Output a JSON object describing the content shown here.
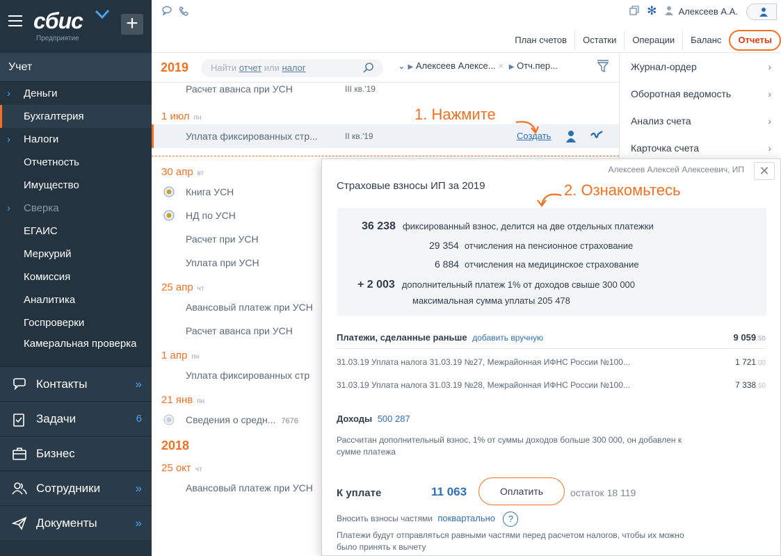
{
  "sidebar": {
    "logo": "сбис",
    "logo_sub": "Предприятие",
    "section": "Учет",
    "items": [
      {
        "label": "Деньги",
        "chevron": true
      },
      {
        "label": "Бухгалтерия",
        "active": true
      },
      {
        "label": "Налоги",
        "chevron": true
      },
      {
        "label": "Отчетность"
      },
      {
        "label": "Имущество"
      },
      {
        "label": "Сверка",
        "chevron": true,
        "muted": true
      },
      {
        "label": "ЕГАИС"
      },
      {
        "label": "Меркурий"
      },
      {
        "label": "Комиссия"
      },
      {
        "label": "Аналитика"
      },
      {
        "label": "Госпроверки"
      },
      {
        "label": "Камеральная проверка"
      }
    ],
    "big_sections": [
      {
        "label": "Контакты",
        "icon": "chat-icon",
        "arrow": "»"
      },
      {
        "label": "Задачи",
        "icon": "tasks-icon",
        "badge": "6"
      },
      {
        "label": "Бизнес",
        "icon": "briefcase-icon"
      },
      {
        "label": "Сотрудники",
        "icon": "people-icon",
        "arrow": "»"
      },
      {
        "label": "Документы",
        "icon": "send-icon",
        "arrow": "»"
      }
    ]
  },
  "topbar": {
    "user": "Алексеев А.А.",
    "tabs": [
      "План счетов",
      "Остатки",
      "Операции",
      "Баланс",
      "Отчеты"
    ],
    "active_tab": "Отчеты"
  },
  "listhead": {
    "year": "2019",
    "search_pre": "Найти ",
    "search_link1": "отчет",
    "search_mid": " или ",
    "search_link2": "налог",
    "filter1": "Алексеев Алексе...",
    "filter2": "Отч.пер..."
  },
  "list": {
    "r0_name": "Расчет аванса при УСН",
    "r0_per": "III кв.'19",
    "d1": "1 июл",
    "d1w": "пн",
    "r1_name": "Уплата фиксированных стр...",
    "r1_per": "II кв.'19",
    "r1_action": "Создать",
    "d2": "30 апр",
    "d2w": "вт",
    "r2": "Книга УСН",
    "r3": "НД по УСН",
    "r4": "Расчет при УСН",
    "r5": "Уплата при УСН",
    "d3": "25 апр",
    "d3w": "чт",
    "r6": "Авансовый платеж при УСН",
    "r7": "Расчет аванса при УСН",
    "d4": "1 апр",
    "d4w": "пн",
    "r8": "Уплата фиксированных стр",
    "d5": "21 янв",
    "d5w": "пн",
    "r9": "Сведения о средн...",
    "r9_num": "7676",
    "y2018": "2018",
    "d6": "25 окт",
    "d6w": "чт",
    "r10": "Авансовый платеж при УСН"
  },
  "rightpanel": {
    "items": [
      "Журнал-ордер",
      "Оборотная ведомость",
      "Анализ счета",
      "Карточка счета"
    ]
  },
  "annotations": {
    "a1": "1. Нажмите",
    "a2": "2. Ознакомьтесь"
  },
  "popup": {
    "company": "Алексеев Алексей Алексеевич, ИП",
    "title": "Страховые взносы ИП за 2019",
    "s1_val": "36 238",
    "s1_txt": "фиксированный взнос, делится на две отдельных платежки",
    "s2_val": "29 354",
    "s2_txt": "отчисления на пенсионное страхование",
    "s3_val": "6 884",
    "s3_txt": "отчисления на медицинское страхование",
    "s4_val": "+ 2 003",
    "s4_txt": "дополнительный платеж 1% от доходов свыше 300 000",
    "s5_txt": "максимальная сумма уплаты 205 478",
    "paid_label": "Платежи, сделанные раньше",
    "paid_add": "добавить вручную",
    "paid_total": "9 059",
    "paid_total_k": ".50",
    "pay1": "31.03.19  Уплата налога 31.03.19 №27, Межрайонная ИФНС России №100...",
    "pay1_amt": "1 721",
    "pay1_k": ".00",
    "pay2": "31.03.19  Уплата налога 31.03.19 №28, Межрайонная ИФНС России №100...",
    "pay2_amt": "7 338",
    "pay2_k": ".50",
    "income_label": "Доходы",
    "income_val": "500 287",
    "income_note1": "Рассчитан дополнительный взнос, 1% от суммы доходов больше 300 000, он добавлен к",
    "income_note2": "сумме платежа",
    "total_label": "К уплате",
    "total_val": "11 063",
    "pay_button": "Оплатить",
    "rest": "остаток 18 119",
    "parts_label": "Вносить взносы частями",
    "parts_link": "поквартально",
    "parts_note1": "Платежи будут отправляться равными частями перед расчетом налогов, чтобы их можно",
    "parts_note2": "было принять к вычету"
  },
  "colors": {
    "accent": "#f37021",
    "link": "#2e6eb5",
    "sidebar": "#233340"
  }
}
